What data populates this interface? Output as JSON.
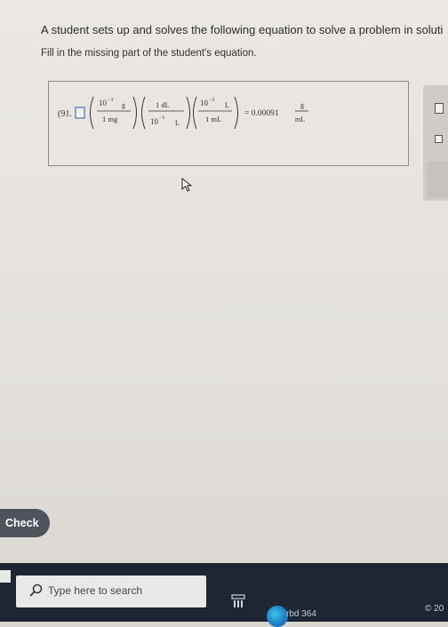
{
  "question": {
    "prompt": "A student sets up and solves the following equation to solve a problem in soluti",
    "instruction": "Fill in the missing part of the student's equation."
  },
  "equation": {
    "leading_value": "(91.",
    "factor1": {
      "num_coeff": "10",
      "num_exp": "−3",
      "num_unit": "g",
      "den": "1 mg"
    },
    "factor2": {
      "num": "1 dL",
      "den_coeff": "10",
      "den_exp": "−1",
      "den_unit": "L"
    },
    "factor3": {
      "num_coeff": "10",
      "num_exp": "−3",
      "num_unit": "L",
      "den": "1 mL"
    },
    "equals": "= 0.00091",
    "result_unit_num": "g",
    "result_unit_den": "mL"
  },
  "buttons": {
    "check": "Check"
  },
  "taskbar": {
    "search_placeholder": "Type here to search",
    "edge_label": "rbd 364",
    "clock": "© 20"
  },
  "icons": [
    "cursor-arrow-icon",
    "search-icon",
    "task-view-icon",
    "edge-icon",
    "windows-icon",
    "answer-blank-icon"
  ]
}
